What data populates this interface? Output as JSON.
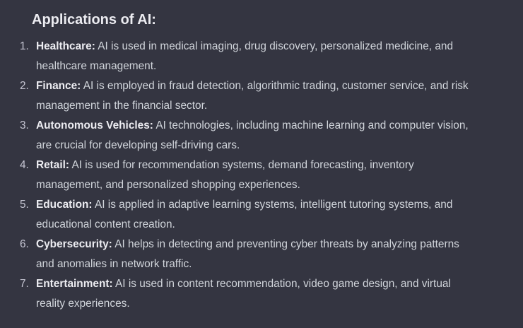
{
  "heading": "Applications of AI:",
  "items": [
    {
      "number": "1.",
      "label": "Healthcare:",
      "text": " AI is used in medical imaging, drug discovery, personalized medicine, and healthcare management."
    },
    {
      "number": "2.",
      "label": "Finance:",
      "text": " AI is employed in fraud detection, algorithmic trading, customer service, and risk management in the financial sector."
    },
    {
      "number": "3.",
      "label": "Autonomous Vehicles:",
      "text": " AI technologies, including machine learning and computer vision, are crucial for developing self-driving cars."
    },
    {
      "number": "4.",
      "label": "Retail:",
      "text": " AI is used for recommendation systems, demand forecasting, inventory management, and personalized shopping experiences."
    },
    {
      "number": "5.",
      "label": "Education:",
      "text": " AI is applied in adaptive learning systems, intelligent tutoring systems, and educational content creation."
    },
    {
      "number": "6.",
      "label": "Cybersecurity:",
      "text": " AI helps in detecting and preventing cyber threats by analyzing patterns and anomalies in network traffic."
    },
    {
      "number": "7.",
      "label": "Entertainment:",
      "text": " AI is used in content recommendation, video game design, and virtual reality experiences."
    }
  ]
}
